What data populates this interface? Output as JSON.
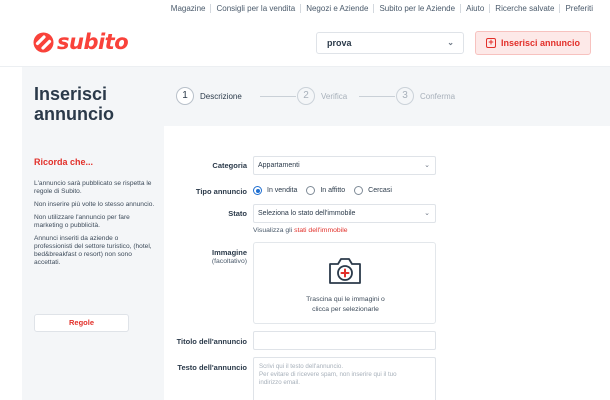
{
  "top_links": [
    "Magazine",
    "Consigli per la vendita",
    "Negozi e Aziende",
    "Subito per le Aziende",
    "Aiuto",
    "Ricerche salvate",
    "Preferiti"
  ],
  "brand": {
    "name": "subito",
    "color": "#f9423a"
  },
  "header": {
    "search_value": "prova",
    "cta_label": "Inserisci annuncio"
  },
  "page_title": "Inserisci annuncio",
  "steps": [
    {
      "num": "1",
      "label": "Descrizione",
      "active": true
    },
    {
      "num": "2",
      "label": "Verifica",
      "active": false
    },
    {
      "num": "3",
      "label": "Conferma",
      "active": false
    }
  ],
  "sidebar": {
    "heading": "Ricorda che...",
    "notes": [
      "L'annuncio sarà pubblicato se rispetta le regole di Subito.",
      "Non inserire più volte lo stesso annuncio.",
      "Non utilizzare l'annuncio per fare marketing o pubblicità.",
      "Annunci inseriti da aziende o professionisti del settore turistico, (hotel, bed&breakfast o resort) non sono accettati."
    ],
    "rules_button": "Regole"
  },
  "form": {
    "categoria": {
      "label": "Categoria",
      "value": "Appartamenti"
    },
    "tipo": {
      "label": "Tipo annuncio",
      "options": [
        "In vendita",
        "In affitto",
        "Cercasi"
      ],
      "selected": "In vendita"
    },
    "stato": {
      "label": "Stato",
      "placeholder": "Seleziona lo stato dell'immobile",
      "hint_prefix": "Visualizza gli",
      "hint_link": "stati dell'immobile"
    },
    "immagine": {
      "label": "Immagine",
      "sublabel": "(facoltativo)",
      "drop_line1": "Trascina qui le immagini o",
      "drop_line2": "clicca per selezionarle"
    },
    "titolo": {
      "label": "Titolo dell'annuncio",
      "value": ""
    },
    "testo": {
      "label": "Testo dell'annuncio",
      "placeholder_line1": "Scrivi qui il testo dell'annuncio.",
      "placeholder_line2": "Per evitare di ricevere spam, non inserire qui il tuo",
      "placeholder_line3": "indirizzo email."
    }
  },
  "icons": {
    "cta": "plus-square-icon",
    "select": "chevron-down-icon",
    "upload": "camera-plus-icon"
  },
  "colors": {
    "accent": "#e2302a",
    "radio": "#1f6fd1",
    "panel": "#f4f6f8"
  }
}
